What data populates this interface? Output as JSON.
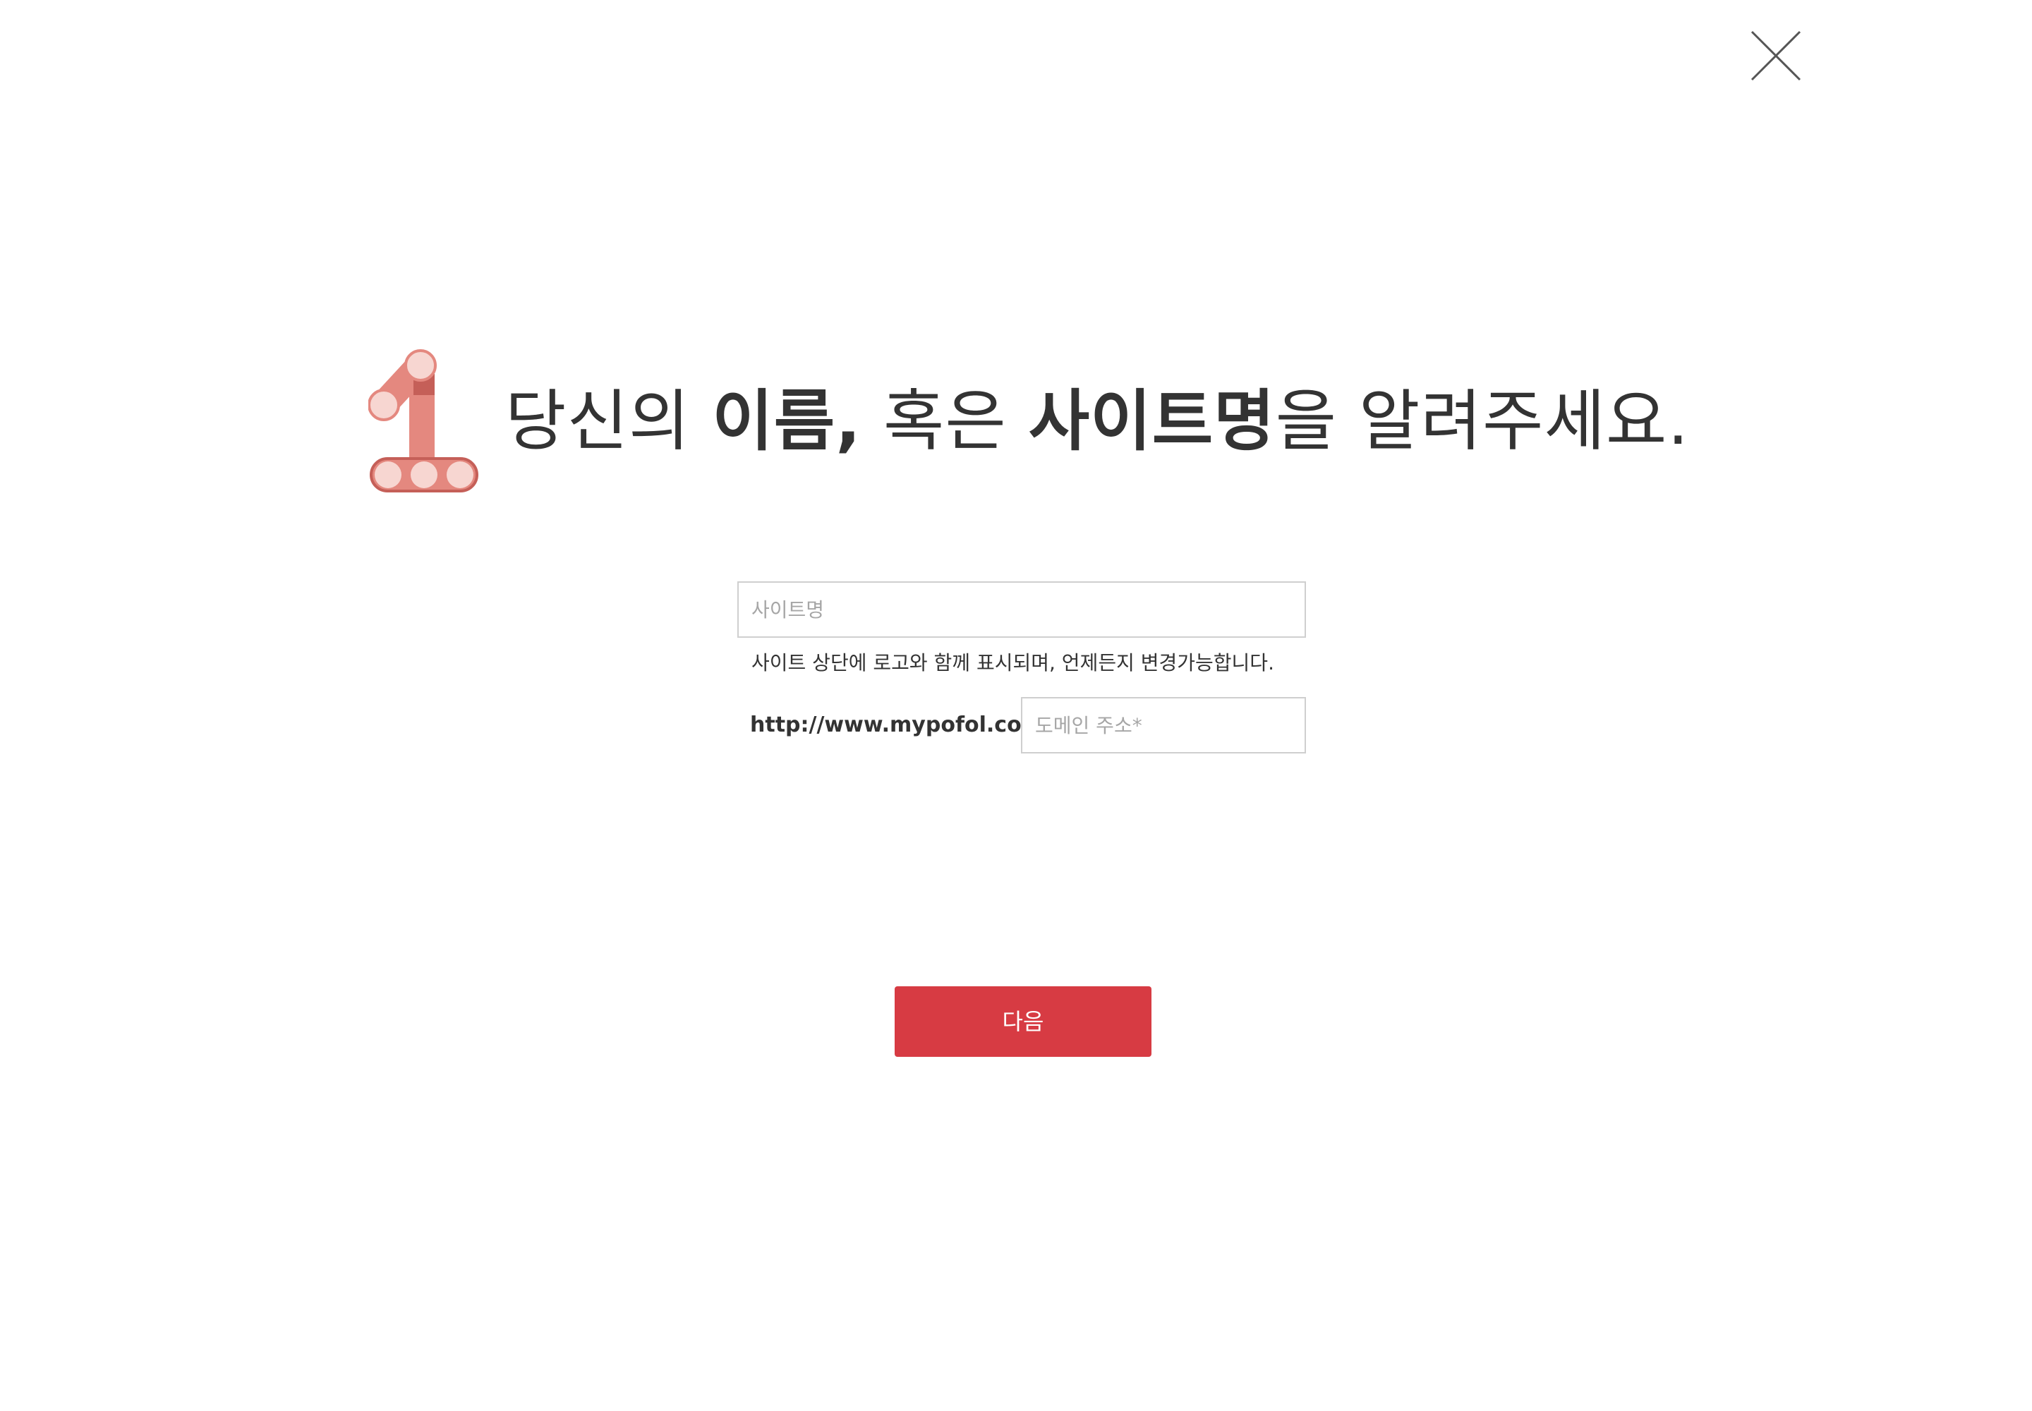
{
  "close": {
    "icon": "close-icon"
  },
  "heading": {
    "step_icon": "number-one-icon",
    "part1": "당신의 ",
    "part2": "이름,",
    "part3": " 혹은 ",
    "part4": "사이트명",
    "part5": "을 알려주세요."
  },
  "form": {
    "site_name": {
      "value": "",
      "placeholder": "사이트명"
    },
    "help_text": "사이트 상단에 로고와 함께 표시되며, 언제든지 변경가능합니다.",
    "domain_prefix": "http://www.mypofol.com/",
    "domain": {
      "value": "",
      "placeholder": "도메인 주소*"
    }
  },
  "next_button": {
    "label": "다음"
  },
  "colors": {
    "accent": "#d73b43",
    "step_icon_main": "#e4887f",
    "step_icon_dark": "#c55f58",
    "step_icon_light": "#f7d6d1",
    "text": "#333333",
    "placeholder": "#a6a6a6",
    "input_border": "#cfcfcf"
  }
}
